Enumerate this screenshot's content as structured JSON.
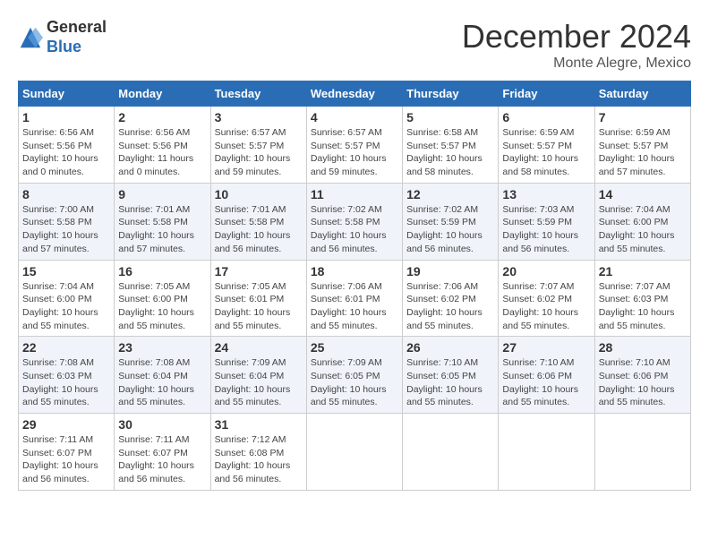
{
  "header": {
    "logo_line1": "General",
    "logo_line2": "Blue",
    "month": "December 2024",
    "location": "Monte Alegre, Mexico"
  },
  "days_of_week": [
    "Sunday",
    "Monday",
    "Tuesday",
    "Wednesday",
    "Thursday",
    "Friday",
    "Saturday"
  ],
  "weeks": [
    [
      {
        "day": 1,
        "sunrise": "6:56 AM",
        "sunset": "5:56 PM",
        "daylight": "10 hours and 0 minutes"
      },
      {
        "day": 2,
        "sunrise": "6:56 AM",
        "sunset": "5:56 PM",
        "daylight": "11 hours and 0 minutes"
      },
      {
        "day": 3,
        "sunrise": "6:57 AM",
        "sunset": "5:57 PM",
        "daylight": "10 hours and 59 minutes"
      },
      {
        "day": 4,
        "sunrise": "6:57 AM",
        "sunset": "5:57 PM",
        "daylight": "10 hours and 59 minutes"
      },
      {
        "day": 5,
        "sunrise": "6:58 AM",
        "sunset": "5:57 PM",
        "daylight": "10 hours and 58 minutes"
      },
      {
        "day": 6,
        "sunrise": "6:59 AM",
        "sunset": "5:57 PM",
        "daylight": "10 hours and 58 minutes"
      },
      {
        "day": 7,
        "sunrise": "6:59 AM",
        "sunset": "5:57 PM",
        "daylight": "10 hours and 57 minutes"
      }
    ],
    [
      {
        "day": 8,
        "sunrise": "7:00 AM",
        "sunset": "5:58 PM",
        "daylight": "10 hours and 57 minutes"
      },
      {
        "day": 9,
        "sunrise": "7:01 AM",
        "sunset": "5:58 PM",
        "daylight": "10 hours and 57 minutes"
      },
      {
        "day": 10,
        "sunrise": "7:01 AM",
        "sunset": "5:58 PM",
        "daylight": "10 hours and 56 minutes"
      },
      {
        "day": 11,
        "sunrise": "7:02 AM",
        "sunset": "5:58 PM",
        "daylight": "10 hours and 56 minutes"
      },
      {
        "day": 12,
        "sunrise": "7:02 AM",
        "sunset": "5:59 PM",
        "daylight": "10 hours and 56 minutes"
      },
      {
        "day": 13,
        "sunrise": "7:03 AM",
        "sunset": "5:59 PM",
        "daylight": "10 hours and 56 minutes"
      },
      {
        "day": 14,
        "sunrise": "7:04 AM",
        "sunset": "6:00 PM",
        "daylight": "10 hours and 55 minutes"
      }
    ],
    [
      {
        "day": 15,
        "sunrise": "7:04 AM",
        "sunset": "6:00 PM",
        "daylight": "10 hours and 55 minutes"
      },
      {
        "day": 16,
        "sunrise": "7:05 AM",
        "sunset": "6:00 PM",
        "daylight": "10 hours and 55 minutes"
      },
      {
        "day": 17,
        "sunrise": "7:05 AM",
        "sunset": "6:01 PM",
        "daylight": "10 hours and 55 minutes"
      },
      {
        "day": 18,
        "sunrise": "7:06 AM",
        "sunset": "6:01 PM",
        "daylight": "10 hours and 55 minutes"
      },
      {
        "day": 19,
        "sunrise": "7:06 AM",
        "sunset": "6:02 PM",
        "daylight": "10 hours and 55 minutes"
      },
      {
        "day": 20,
        "sunrise": "7:07 AM",
        "sunset": "6:02 PM",
        "daylight": "10 hours and 55 minutes"
      },
      {
        "day": 21,
        "sunrise": "7:07 AM",
        "sunset": "6:03 PM",
        "daylight": "10 hours and 55 minutes"
      }
    ],
    [
      {
        "day": 22,
        "sunrise": "7:08 AM",
        "sunset": "6:03 PM",
        "daylight": "10 hours and 55 minutes"
      },
      {
        "day": 23,
        "sunrise": "7:08 AM",
        "sunset": "6:04 PM",
        "daylight": "10 hours and 55 minutes"
      },
      {
        "day": 24,
        "sunrise": "7:09 AM",
        "sunset": "6:04 PM",
        "daylight": "10 hours and 55 minutes"
      },
      {
        "day": 25,
        "sunrise": "7:09 AM",
        "sunset": "6:05 PM",
        "daylight": "10 hours and 55 minutes"
      },
      {
        "day": 26,
        "sunrise": "7:10 AM",
        "sunset": "6:05 PM",
        "daylight": "10 hours and 55 minutes"
      },
      {
        "day": 27,
        "sunrise": "7:10 AM",
        "sunset": "6:06 PM",
        "daylight": "10 hours and 55 minutes"
      },
      {
        "day": 28,
        "sunrise": "7:10 AM",
        "sunset": "6:06 PM",
        "daylight": "10 hours and 55 minutes"
      }
    ],
    [
      {
        "day": 29,
        "sunrise": "7:11 AM",
        "sunset": "6:07 PM",
        "daylight": "10 hours and 56 minutes"
      },
      {
        "day": 30,
        "sunrise": "7:11 AM",
        "sunset": "6:07 PM",
        "daylight": "10 hours and 56 minutes"
      },
      {
        "day": 31,
        "sunrise": "7:12 AM",
        "sunset": "6:08 PM",
        "daylight": "10 hours and 56 minutes"
      },
      null,
      null,
      null,
      null
    ]
  ]
}
